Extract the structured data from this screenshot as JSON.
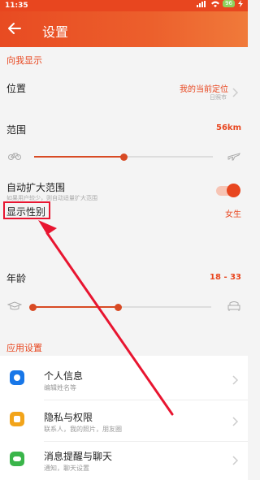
{
  "statusbar": {
    "time": "11:35",
    "battery": "96"
  },
  "header": {
    "title": "设置"
  },
  "sections": {
    "show_me": "向我显示",
    "app_settings": "应用设置"
  },
  "location": {
    "label": "位置",
    "value": "我的当前定位",
    "sub": "日照市"
  },
  "range": {
    "label": "范围",
    "value": "56km",
    "level_fraction": 0.5
  },
  "auto_expand": {
    "label": "自动扩大范围",
    "sub": "如果用户较少，则自动适量扩大范围",
    "enabled": true
  },
  "gender": {
    "label": "显示性别",
    "value": "女生"
  },
  "age": {
    "label": "年龄",
    "value": "18 - 33"
  },
  "items": [
    {
      "title": "个人信息",
      "sub": "编辑姓名等",
      "icon": "person-icon",
      "color": "#1877e8"
    },
    {
      "title": "隐私与权限",
      "sub": "联系人，我的照片，朋友圈",
      "icon": "lock-icon",
      "color": "#f2a41a"
    },
    {
      "title": "消息提醒与聊天",
      "sub": "通知，聊天设置",
      "icon": "chat-icon",
      "color": "#3ab54a"
    }
  ],
  "colors": {
    "accent": "#e8461f",
    "annotation": "#e81530"
  }
}
